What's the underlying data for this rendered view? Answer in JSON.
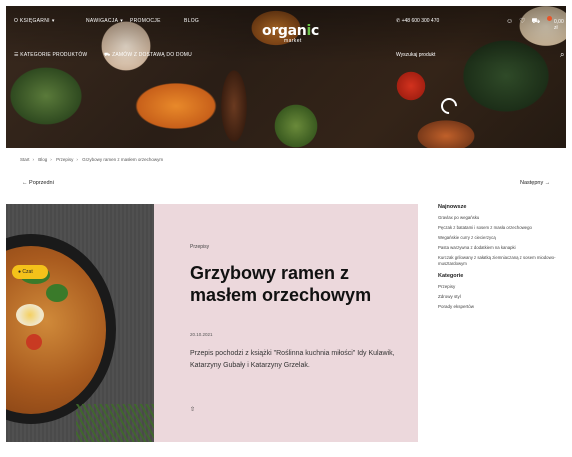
{
  "header": {
    "top_left_links": [
      {
        "label": "O KSIĘGARNI"
      },
      {
        "label": "NAWIGACJA"
      },
      {
        "label": "PROMOCJE"
      },
      {
        "label": "BLOG"
      }
    ],
    "logo_text_a": "organ",
    "logo_text_b": "i",
    "logo_text_c": "c",
    "logo_sub": "market",
    "phone": "+48 600 300 470",
    "cart_total": "0,00 zł",
    "nav_left": [
      {
        "label": "KATEGORIE PRODUKTÓW"
      },
      {
        "label": "ZAMÓW Z DOSTAWĄ DO DOMU"
      }
    ],
    "search_link": "Wyszukaj produkt"
  },
  "breadcrumb": [
    "Start",
    "Blog",
    "Przepisy",
    "Grzybowy ramen z masłem orzechowym"
  ],
  "post_nav": {
    "prev": "Poprzedni",
    "next": "Następny"
  },
  "article": {
    "category": "Przepisy",
    "title": "Grzybowy ramen z masłem orzechowym",
    "date": "20.10.2021",
    "description": "Przepis pochodzi z książki \"Roślinna kuchnia miłości\" Idy Kulawik, Katarzyny Gubały i Katarzyny Grzelak.",
    "share_icon": "share-icon"
  },
  "chat": {
    "label": "Czat"
  },
  "sidebar": {
    "latest_heading": "Najnowsze",
    "latest": [
      "Gravlax po wegańsku",
      "Pęczak z batatami i sosem z masła orzechowego",
      "Wegańskie curry z ciecierzycą",
      "Pasta warzywna z dodatkiem na kanapki",
      "Kurczak grilowany z sałatką ziemniaczaną z sosem miodowo-musztardowym"
    ],
    "categories_heading": "Kategorie",
    "categories": [
      "Przepisy",
      "Zdrowy styl",
      "Porady ekspertów"
    ]
  },
  "colors": {
    "card_bg": "#ecd8dc",
    "chat_btn": "#f4c21a",
    "accent_green": "#6cc24a"
  }
}
